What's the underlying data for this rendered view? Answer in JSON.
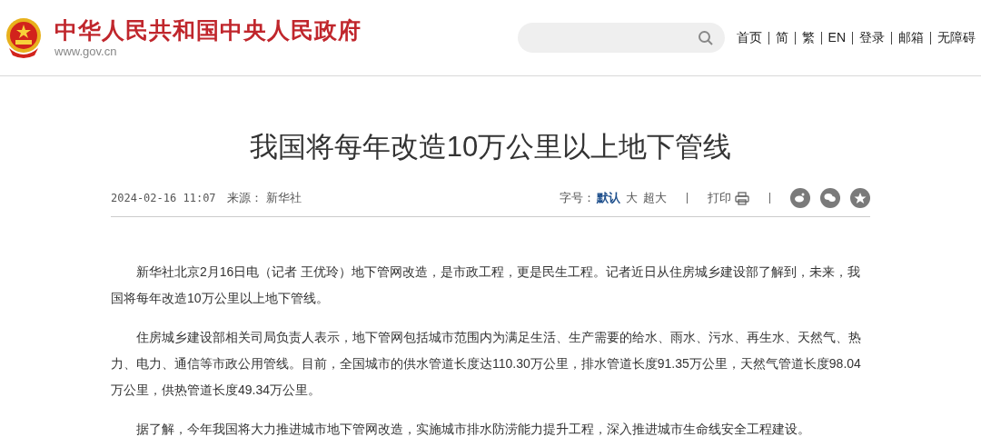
{
  "header": {
    "site_title": "中华人民共和国中央人民政府",
    "site_url": "www.gov.cn",
    "nav": [
      {
        "label": "首页"
      },
      {
        "label": "简"
      },
      {
        "label": "繁"
      },
      {
        "label": "EN"
      },
      {
        "label": "登录"
      },
      {
        "label": "邮箱"
      },
      {
        "label": "无障碍"
      }
    ]
  },
  "article": {
    "title": "我国将每年改造10万公里以上地下管线",
    "date": "2024-02-16 11:07",
    "source_label": "来源：",
    "source": "新华社",
    "font_size": {
      "label": "字号：",
      "options": [
        {
          "label": "默认",
          "selected": true
        },
        {
          "label": "大",
          "selected": false
        },
        {
          "label": "超大",
          "selected": false
        }
      ]
    },
    "print": "打印",
    "share": [
      {
        "kind": "weibo"
      },
      {
        "kind": "wechat"
      },
      {
        "kind": "favorite"
      }
    ],
    "paragraphs": [
      "新华社北京2月16日电（记者 王优玲）地下管网改造，是市政工程，更是民生工程。记者近日从住房城乡建设部了解到，未来，我国将每年改造10万公里以上地下管线。",
      "住房城乡建设部相关司局负责人表示，地下管网包括城市范围内为满足生活、生产需要的给水、雨水、污水、再生水、天然气、热力、电力、通信等市政公用管线。目前，全国城市的供水管道长度达110.30万公里，排水管道长度91.35万公里，天然气管道长度98.04万公里，供热管道长度49.34万公里。",
      "据了解，今年我国将大力推进城市地下管网改造，实施城市排水防涝能力提升工程，深入推进城市生命线安全工程建设。"
    ]
  }
}
